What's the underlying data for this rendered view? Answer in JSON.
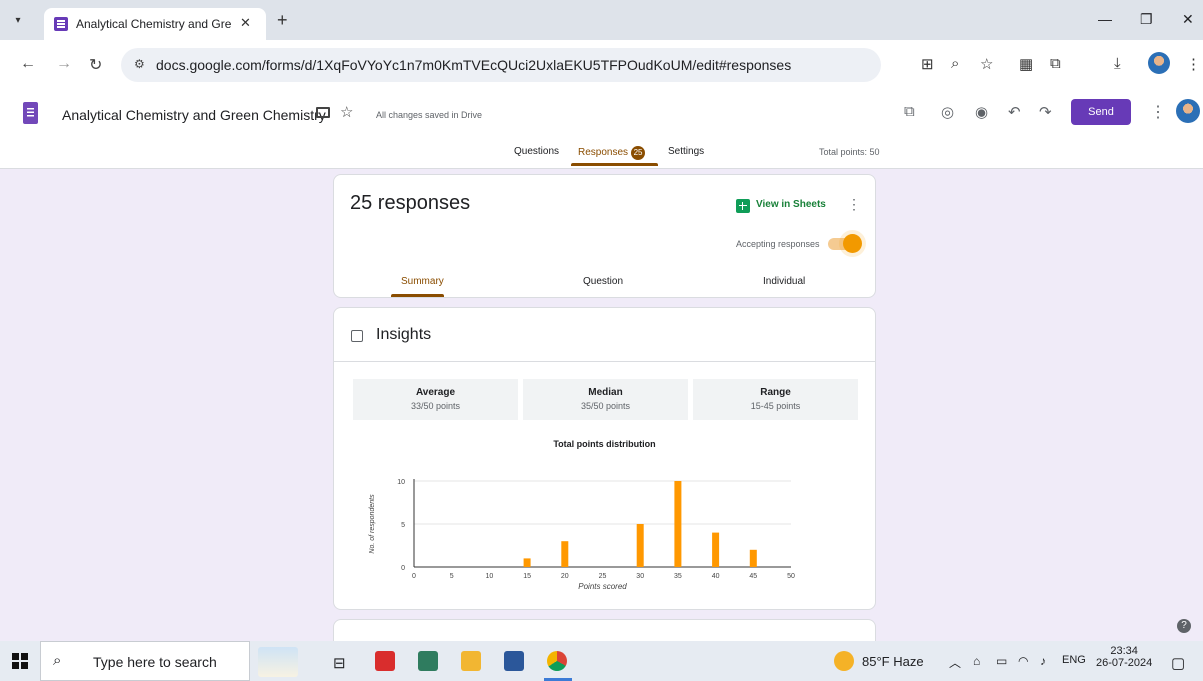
{
  "browser": {
    "tab_title": "Analytical Chemistry and Green",
    "url": "docs.google.com/forms/d/1XqFoVYoYc1n7m0KmTVEcQUci2UxlaEKU5TFPOudKoUM/edit#responses"
  },
  "form": {
    "title": "Analytical Chemistry and Green Chemistry",
    "save_status": "All changes saved in Drive",
    "send_label": "Send",
    "tabs": [
      {
        "label": "Questions"
      },
      {
        "label": "Responses",
        "badge": "25"
      },
      {
        "label": "Settings"
      }
    ],
    "total_points": "Total points: 50"
  },
  "responses": {
    "count_label": "25 responses",
    "view_in_sheets": "View in Sheets",
    "accepting_label": "Accepting responses",
    "accepting": true,
    "subtabs": [
      "Summary",
      "Question",
      "Individual"
    ]
  },
  "insights": {
    "title": "Insights",
    "stats": [
      {
        "label": "Average",
        "value": "33/50 points"
      },
      {
        "label": "Median",
        "value": "35/50 points"
      },
      {
        "label": "Range",
        "value": "15-45 points"
      }
    ]
  },
  "chart_data": {
    "type": "bar",
    "title": "Total points distribution",
    "xlabel": "Points scored",
    "ylabel": "No. of respondents",
    "x": [
      15,
      20,
      30,
      35,
      40,
      45
    ],
    "values": [
      1,
      3,
      5,
      10,
      4,
      2
    ],
    "xticks": [
      0,
      5,
      10,
      15,
      20,
      25,
      30,
      35,
      40,
      45,
      50
    ],
    "yticks": [
      0,
      5,
      10
    ],
    "xlim": [
      0,
      50
    ],
    "ylim": [
      0,
      10
    ],
    "bar_color": "#ff9800",
    "grid": true
  },
  "taskbar": {
    "search_placeholder": "Type here to search",
    "weather": "85°F Haze",
    "language": "ENG",
    "time": "23:34",
    "date": "26-07-2024"
  },
  "colors": {
    "accent": "#673ab7",
    "responses_accent": "#8a4d00",
    "sheets_green": "#188038",
    "toggle_on": "#f29900"
  }
}
